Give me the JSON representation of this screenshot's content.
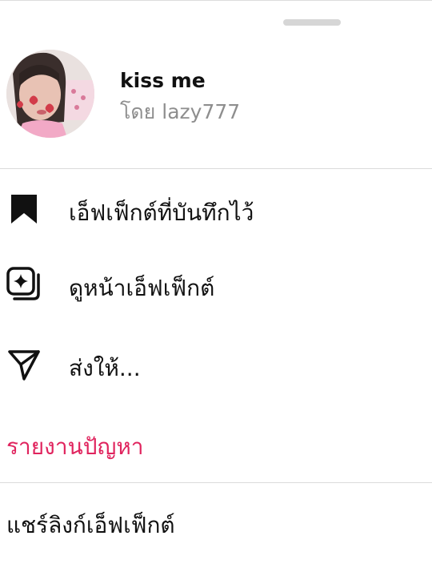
{
  "effect": {
    "title": "kiss me",
    "author": "โดย lazy777"
  },
  "menu": [
    {
      "label": "เอ็ฟเฟ็กต์ที่บันทึกไว้",
      "icon": "bookmark-icon"
    },
    {
      "label": "ดูหน้าเอ็ฟเฟ็กต์",
      "icon": "effect-page-icon"
    },
    {
      "label": "ส่งให้...",
      "icon": "send-icon"
    }
  ],
  "report": {
    "label": "รายงานปัญหา",
    "color": "#e0245e"
  },
  "share": {
    "label": "แชร์ลิงก์เอ็ฟเฟ็กต์"
  },
  "colors": {
    "accent": "#e0245e",
    "muted": "#8e8e8e",
    "text": "#111111"
  }
}
